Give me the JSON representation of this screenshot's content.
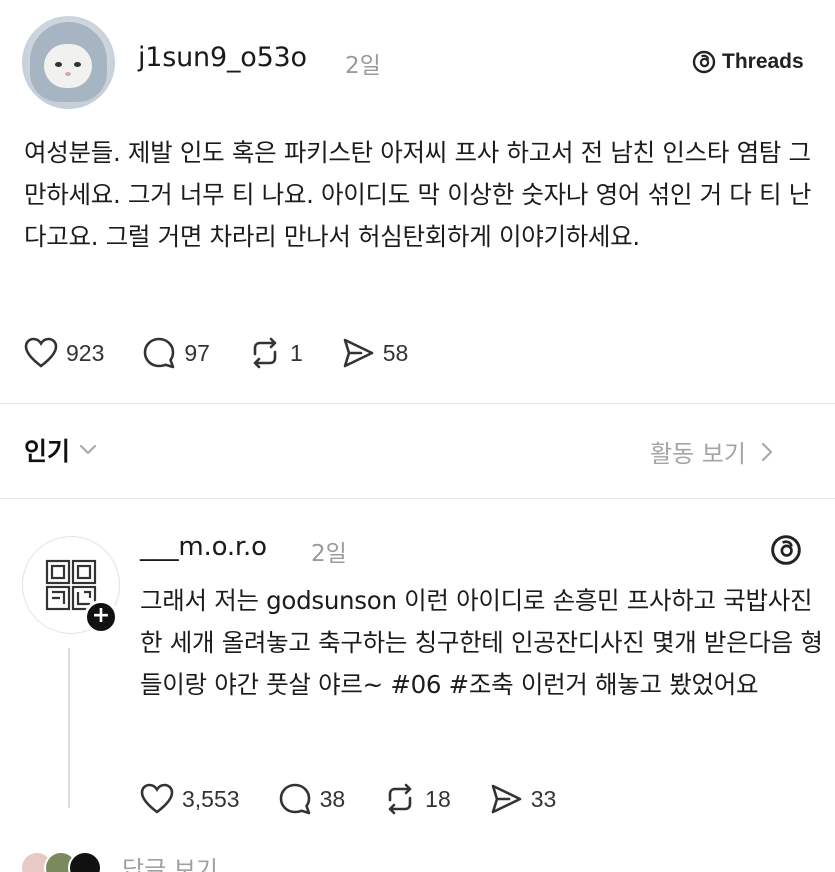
{
  "post": {
    "username": "j1sun9_o53o",
    "time": "2일",
    "badge": "Threads",
    "text": "여성분들. 제발 인도 혹은 파키스탄 아저씨 프사 하고서 전 남친 인스타 염탐 그만하세요. 그거 너무 티 나요. 아이디도 막 이상한 숫자나 영어 섞인 거 다 티 난다고요. 그럴 거면 차라리 만나서 허심탄회하게 이야기하세요.",
    "likes": "923",
    "comments": "97",
    "reposts": "1",
    "shares": "58"
  },
  "sort": {
    "label": "인기",
    "activity_label": "활동 보기"
  },
  "reply": {
    "username": "___m.o.r.o",
    "time": "2일",
    "text": "그래서 저는 godsunson 이런 아이디로 손흥민 프사하고 국밥사진 한 세개 올려놓고 축구하는 칭구한테 인공잔디사진 몇개 받은다음 형들이랑 야간 풋살 야르~ #06 #조축  이런거 해놓고 봤었어요",
    "likes": "3,553",
    "comments": "38",
    "reposts": "18",
    "shares": "33"
  },
  "more_replies": {
    "label": "답글 보기"
  },
  "icons": {
    "like": "heart-icon",
    "comment": "comment-bubble-icon",
    "repost": "repost-icon",
    "share": "send-icon",
    "threads": "threads-logo-icon",
    "dropdown": "chevron-down-icon",
    "activity": "chevron-right-icon",
    "follow": "plus-icon"
  }
}
